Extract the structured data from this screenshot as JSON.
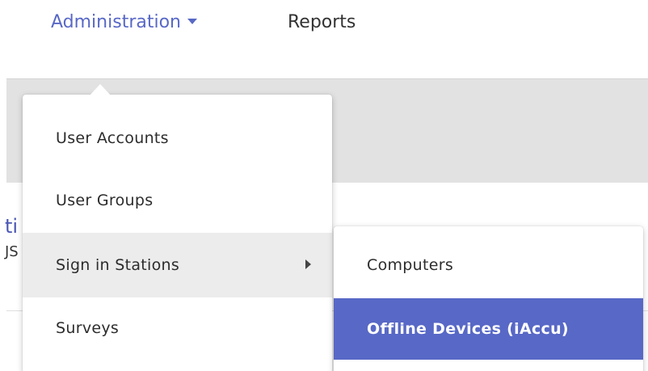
{
  "nav": {
    "items": [
      {
        "label": "Administration",
        "active": true
      },
      {
        "label": "Reports",
        "active": false
      }
    ]
  },
  "background": {
    "title_fragment": "ti",
    "sub_fragment": "JS"
  },
  "admin_menu": {
    "items": [
      {
        "label": "User Accounts"
      },
      {
        "label": "User Groups"
      },
      {
        "label": "Sign in Stations",
        "has_submenu": true,
        "hovered": true
      },
      {
        "label": "Surveys"
      }
    ]
  },
  "sign_in_submenu": {
    "items": [
      {
        "label": "Computers",
        "highlighted": false
      },
      {
        "label": "Offline Devices (iAccu)",
        "highlighted": true
      }
    ]
  },
  "colors": {
    "accent": "#5868c6",
    "hover_bg": "#ececec",
    "band_bg": "#e2e2e2"
  }
}
